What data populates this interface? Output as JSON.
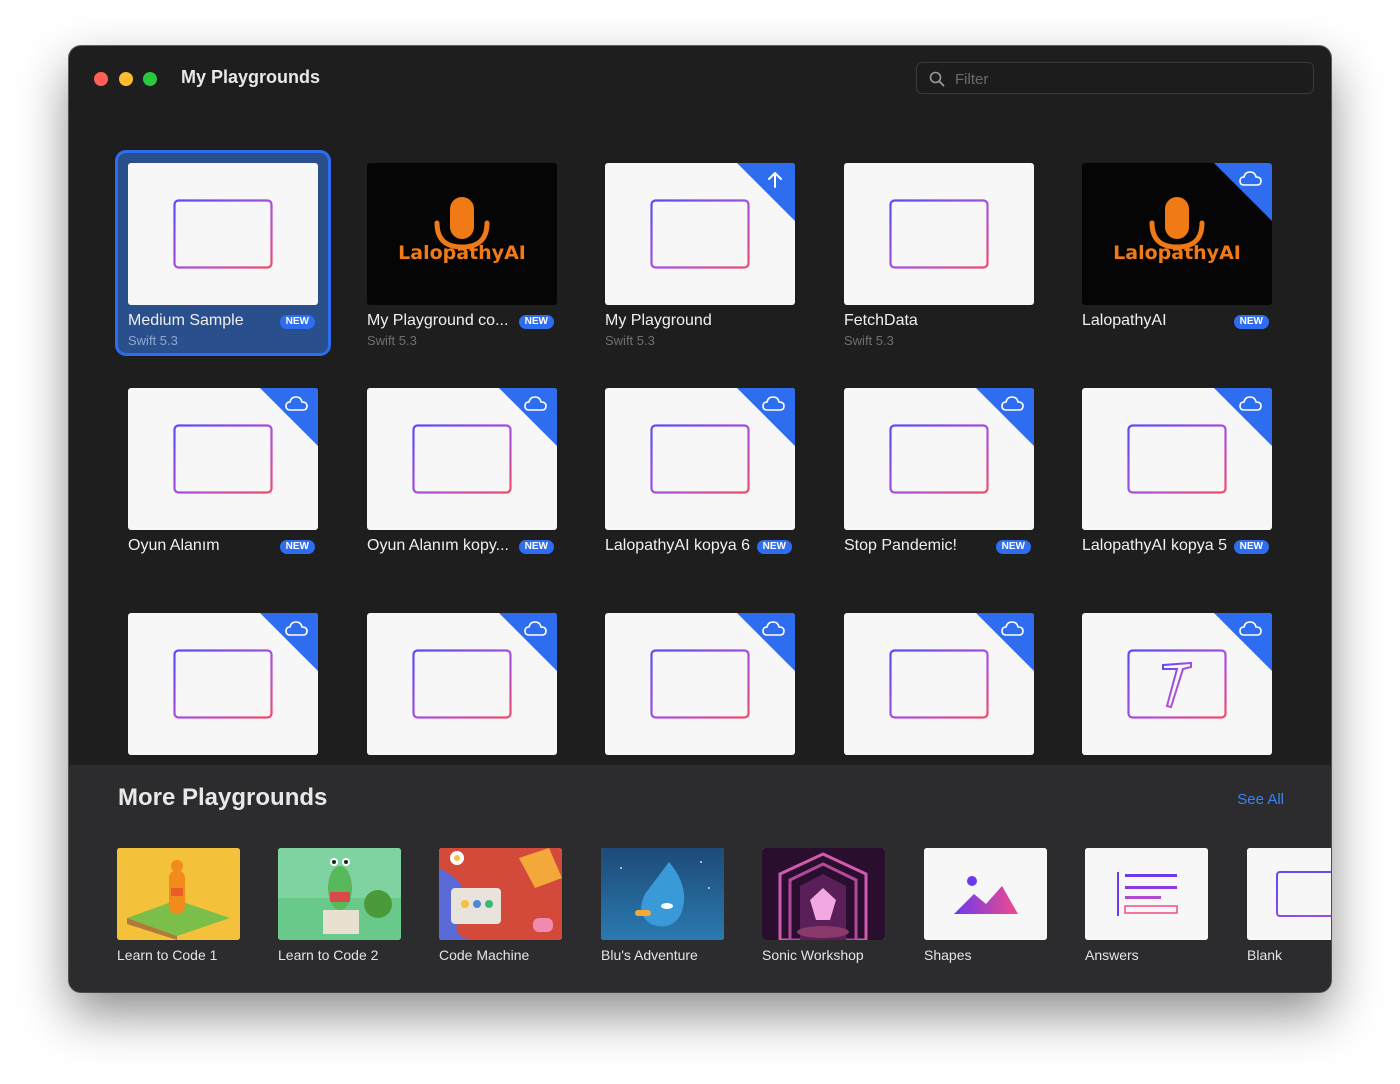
{
  "window": {
    "title": "My Playgrounds"
  },
  "filter": {
    "placeholder": "Filter"
  },
  "playgrounds": [
    {
      "name": "Medium Sample",
      "sub": "Swift 5.3",
      "badge": "NEW",
      "corner": "",
      "art": "frame",
      "selected": true
    },
    {
      "name": "My Playground co...",
      "sub": "Swift 5.3",
      "badge": "NEW",
      "corner": "",
      "art": "lalo",
      "selected": false
    },
    {
      "name": "My Playground",
      "sub": "Swift 5.3",
      "badge": "",
      "corner": "upload",
      "art": "frame",
      "selected": false
    },
    {
      "name": "FetchData",
      "sub": "Swift 5.3",
      "badge": "",
      "corner": "",
      "art": "frame",
      "selected": false
    },
    {
      "name": "LalopathyAI",
      "sub": "",
      "badge": "NEW",
      "corner": "cloud",
      "art": "lalo",
      "selected": false
    },
    {
      "name": "Oyun Alanım",
      "sub": "",
      "badge": "NEW",
      "corner": "cloud",
      "art": "frame",
      "selected": false
    },
    {
      "name": "Oyun Alanım kopy...",
      "sub": "",
      "badge": "NEW",
      "corner": "cloud",
      "art": "frame",
      "selected": false
    },
    {
      "name": "LalopathyAI kopya 6",
      "sub": "",
      "badge": "NEW",
      "corner": "cloud",
      "art": "frame",
      "selected": false
    },
    {
      "name": "Stop Pandemic!",
      "sub": "",
      "badge": "NEW",
      "corner": "cloud",
      "art": "frame",
      "selected": false
    },
    {
      "name": "LalopathyAI kopya 5",
      "sub": "",
      "badge": "NEW",
      "corner": "cloud",
      "art": "frame",
      "selected": false
    },
    {
      "name": "",
      "sub": "",
      "badge": "",
      "corner": "cloud",
      "art": "frame",
      "selected": false
    },
    {
      "name": "",
      "sub": "",
      "badge": "",
      "corner": "cloud",
      "art": "frame",
      "selected": false
    },
    {
      "name": "",
      "sub": "",
      "badge": "",
      "corner": "cloud",
      "art": "frame",
      "selected": false
    },
    {
      "name": "",
      "sub": "",
      "badge": "",
      "corner": "cloud",
      "art": "frame",
      "selected": false
    },
    {
      "name": "",
      "sub": "",
      "badge": "",
      "corner": "cloud",
      "art": "hammer",
      "selected": false
    }
  ],
  "logo_text": "LalopathyAI",
  "more": {
    "title": "More Playgrounds",
    "see_all": "See All",
    "books": [
      {
        "name": "Learn to Code 1",
        "art": "ltc1"
      },
      {
        "name": "Learn to Code 2",
        "art": "ltc2"
      },
      {
        "name": "Code Machine",
        "art": "machine"
      },
      {
        "name": "Blu's Adventure",
        "art": "blu"
      },
      {
        "name": "Sonic Workshop",
        "art": "sonic"
      },
      {
        "name": "Shapes",
        "art": "shapes"
      },
      {
        "name": "Answers",
        "art": "answers"
      },
      {
        "name": "Blank",
        "art": "blank"
      }
    ]
  },
  "colors": {
    "accent": "#2f6df0",
    "window_bg": "#1e1e1e",
    "tray_bg": "#2c2c2e",
    "logo_orange": "#f07a16"
  }
}
